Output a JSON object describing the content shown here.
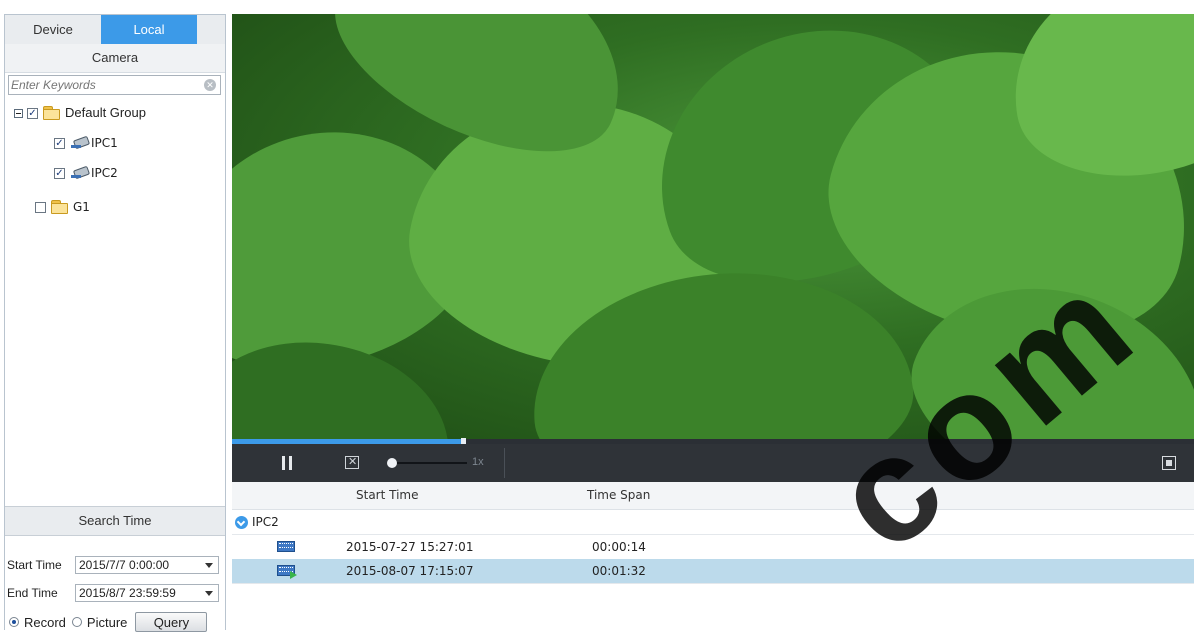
{
  "left_panel": {
    "tabs": [
      {
        "label": "Device"
      },
      {
        "label": "Local"
      }
    ],
    "camera_header": "Camera",
    "search": {
      "placeholder": "Enter Keywords",
      "value": ""
    },
    "tree": {
      "default_group": {
        "label": "Default Group",
        "checked": true,
        "expanded": true
      },
      "ipc1": {
        "label": "IPC1",
        "checked": true
      },
      "ipc2": {
        "label": "IPC2",
        "checked": true
      },
      "g1": {
        "label": "G1",
        "checked": false
      }
    },
    "search_time_header": "Search Time",
    "start_time": {
      "label": "Start Time",
      "value": "2015/7/7 0:00:00"
    },
    "end_time": {
      "label": "End Time",
      "value": "2015/8/7 23:59:59"
    },
    "mode": {
      "record_label": "Record",
      "picture_label": "Picture",
      "selected": "Record"
    },
    "query_label": "Query"
  },
  "player": {
    "progress": 0.24,
    "speed_label": "1x"
  },
  "records": {
    "columns": {
      "start_time": "Start Time",
      "time_span": "Time Span"
    },
    "group": "IPC2",
    "rows": [
      {
        "start": "2015-07-27 15:27:01",
        "span": "00:00:14",
        "selected": false
      },
      {
        "start": "2015-08-07 17:15:07",
        "span": "00:01:32",
        "selected": true
      }
    ]
  },
  "watermark": "com",
  "colors": {
    "accent": "#3c9ae8",
    "selected_row": "#bcdaeb",
    "control_bar": "#2f3338"
  }
}
